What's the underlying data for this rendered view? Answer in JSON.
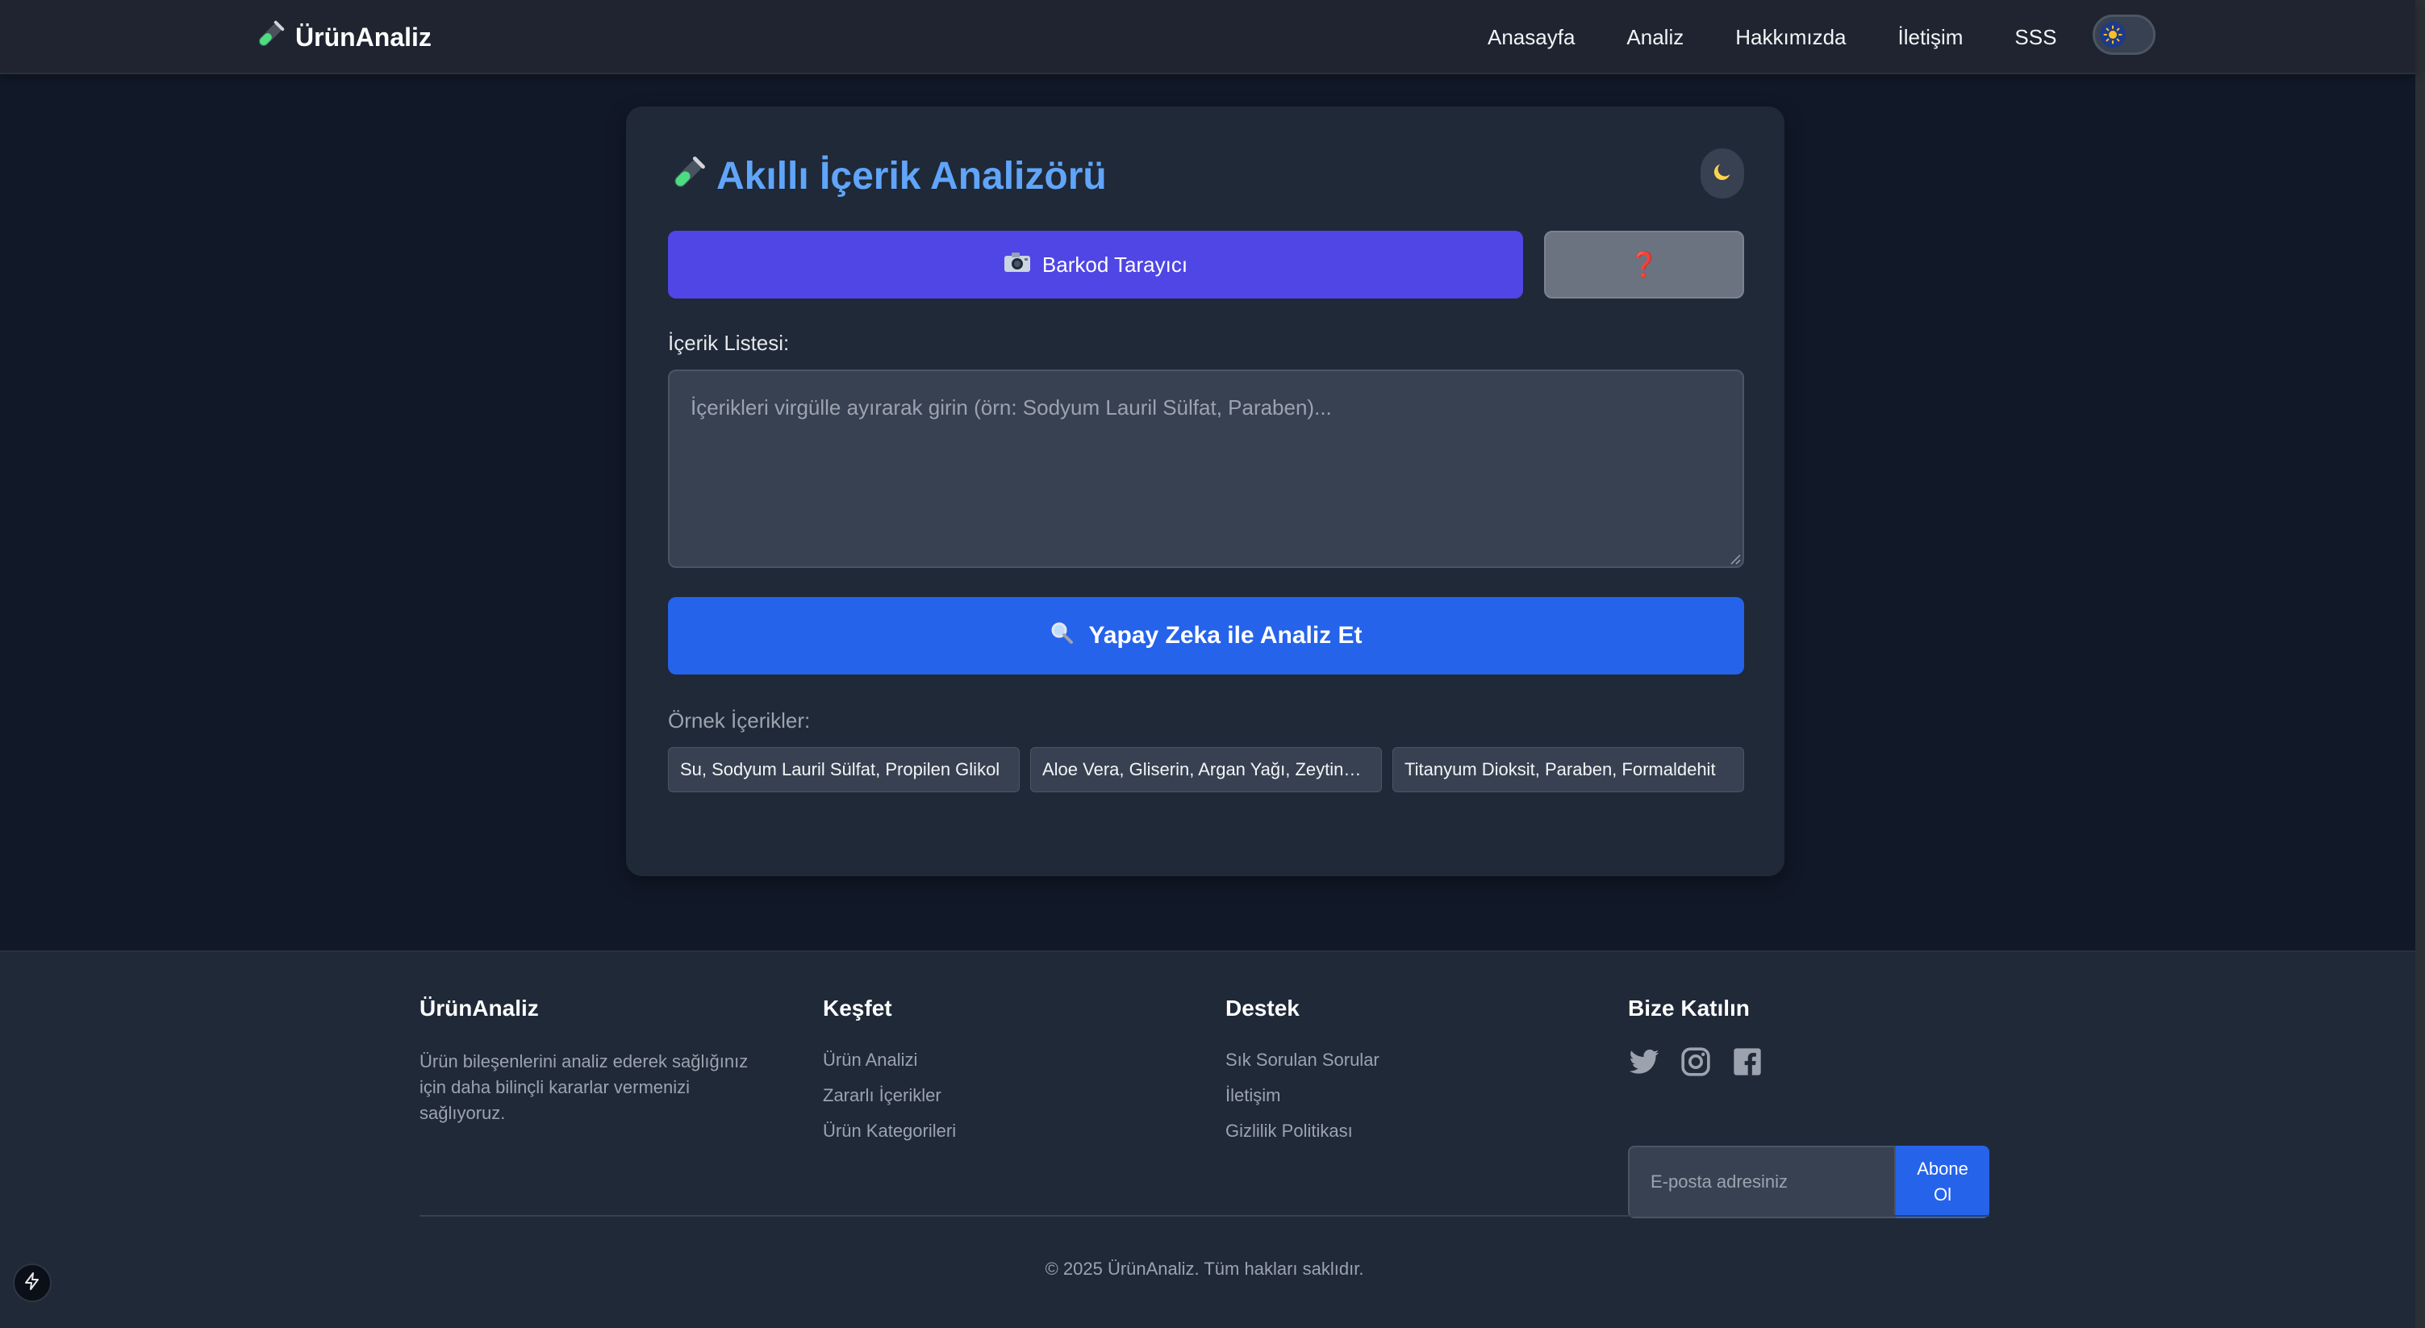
{
  "navbar": {
    "brand": "ÜrünAnaliz",
    "brand_icon": "test-tube-icon",
    "links": [
      {
        "label": "Anasayfa"
      },
      {
        "label": "Analiz"
      },
      {
        "label": "Hakkımızda"
      },
      {
        "label": "İletişim"
      },
      {
        "label": "SSS"
      }
    ],
    "theme_toggle_icon": "sun-icon"
  },
  "analyzer": {
    "title": "Akıllı İçerik Analizörü",
    "title_icon": "test-tube-icon",
    "dark_mode_icon": "moon-icon",
    "barcode_button": "Barkod Tarayıcı",
    "barcode_icon": "camera-icon",
    "help_button": "❓",
    "ingredients_label": "İçerik Listesi:",
    "ingredients_value": "",
    "ingredients_placeholder": "İçerikleri virgülle ayırarak girin (örn: Sodyum Lauril Sülfat, Paraben)...",
    "analyze_button": "Yapay Zeka ile Analiz Et",
    "analyze_icon": "magnifier-icon",
    "examples_label": "Örnek İçerikler:",
    "examples": [
      {
        "label": "Su, Sodyum Lauril Sülfat, Propilen Glikol"
      },
      {
        "label": "Aloe Vera, Gliserin, Argan Yağı, Zeytinyağı"
      },
      {
        "label": "Titanyum Dioksit, Paraben, Formaldehit"
      }
    ]
  },
  "footer": {
    "about": {
      "heading": "ÜrünAnaliz",
      "text": "Ürün bileşenlerini analiz ederek sağlığınız için daha bilinçli kararlar vermenizi sağlıyoruz."
    },
    "explore": {
      "heading": "Keşfet",
      "links": [
        {
          "label": "Ürün Analizi"
        },
        {
          "label": "Zararlı İçerikler"
        },
        {
          "label": "Ürün Kategorileri"
        }
      ]
    },
    "support": {
      "heading": "Destek",
      "links": [
        {
          "label": "Sık Sorulan Sorular"
        },
        {
          "label": "İletişim"
        },
        {
          "label": "Gizlilik Politikası"
        }
      ]
    },
    "join": {
      "heading": "Bize Katılın",
      "social_icons": [
        "twitter-icon",
        "instagram-icon",
        "facebook-icon"
      ],
      "email_placeholder": "E-posta adresiniz",
      "email_value": "",
      "subscribe_button": "Abone Ol"
    },
    "copyright": "© 2025 ÜrünAnaliz. Tüm hakları saklıdır."
  },
  "colors": {
    "page_bg": "#111827",
    "navbar_bg": "#1f2430",
    "card_bg": "#1f2937",
    "title_accent": "#60a5fa",
    "barcode_button": "#4f46e5",
    "analyze_button": "#2563eb",
    "help_button": "#6b7280"
  }
}
